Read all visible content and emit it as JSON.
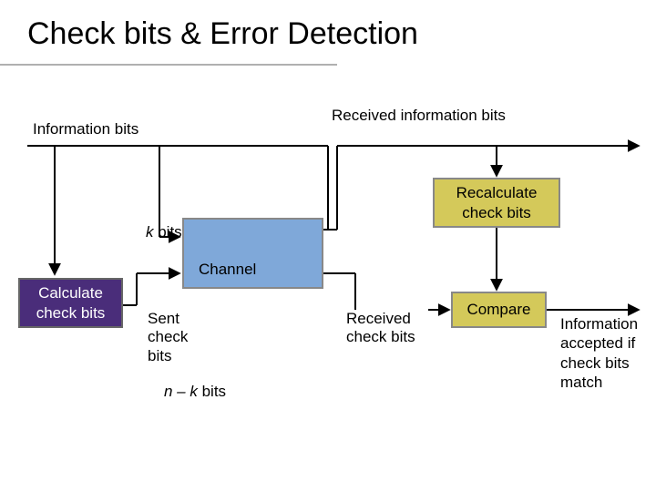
{
  "title": "Check bits & Error Detection",
  "labels": {
    "info_bits": "Information bits",
    "recv_info_bits": "Received information bits",
    "k_bits_prefix": "k",
    "k_bits_suffix": " bits",
    "channel": "Channel",
    "sent_check_bits": "Sent check bits",
    "n_minus_k_prefix": "n – k",
    "n_minus_k_suffix": " bits",
    "recv_check_bits": "Received check bits",
    "info_accept": "Information accepted if check bits match"
  },
  "boxes": {
    "calc": "Calculate check bits",
    "recalc": "Recalculate check bits",
    "compare": "Compare"
  }
}
